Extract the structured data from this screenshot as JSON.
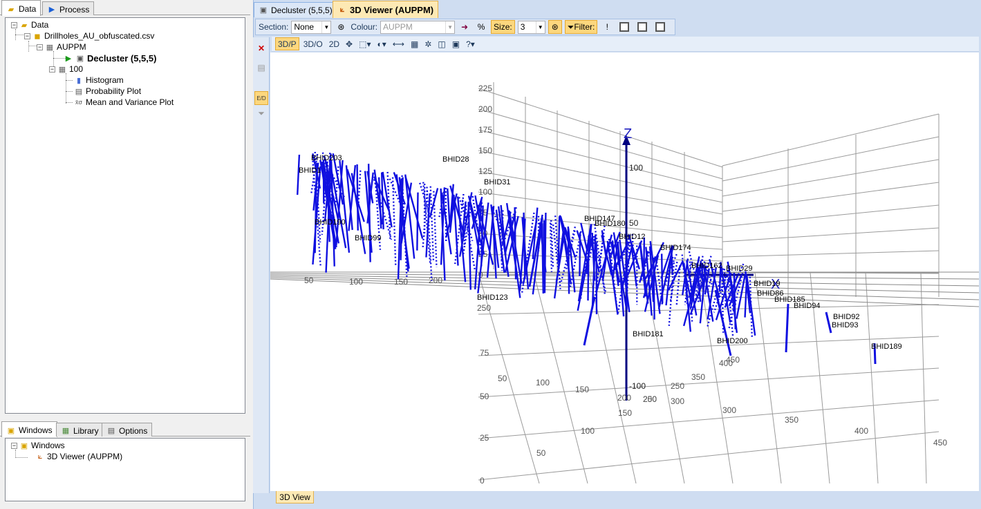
{
  "left_tabs": [
    {
      "label": "Data"
    },
    {
      "label": "Process"
    }
  ],
  "tree": {
    "root": "Data",
    "file": "Drillholes_AU_obfuscated.csv",
    "variable": "AUPPM",
    "decluster": "Decluster (5,5,5)",
    "group": "100",
    "children": [
      "Histogram",
      "Probability Plot",
      "Mean and Variance Plot"
    ]
  },
  "bottom_tabs": [
    {
      "label": "Windows"
    },
    {
      "label": "Library"
    },
    {
      "label": "Options"
    }
  ],
  "windows": {
    "root": "Windows",
    "item": "3D Viewer (AUPPM)"
  },
  "doc_tabs": [
    {
      "label": "Decluster (5,5,5)"
    },
    {
      "label": "3D Viewer (AUPPM)"
    }
  ],
  "toolbar": {
    "section_label": "Section:",
    "section_value": "None",
    "colour_label": "Colour:",
    "colour_value": "AUPPM",
    "percent_label": "%",
    "size_label": "Size:",
    "size_value": "3",
    "filter_label": "Filter:",
    "bang_label": "!"
  },
  "view_toolbar": {
    "btn_3dp": "3D/P",
    "btn_3do": "3D/O",
    "btn_2d": "2D",
    "help": "?"
  },
  "bottom_view_tab": "3D View",
  "viewer": {
    "axis_z": "Z",
    "axis_x": "X",
    "z_ticks": [
      "100",
      "50",
      "-100"
    ],
    "back_ticks": [
      "225",
      "200",
      "175",
      "150",
      "125",
      "100",
      "75",
      "50",
      "25",
      "0"
    ],
    "floor_ticks_a": [
      "50",
      "100",
      "150",
      "200",
      "250",
      "300",
      "350",
      "400",
      "450"
    ],
    "floor_ticks_b": [
      "50",
      "100",
      "150",
      "200",
      "250",
      "300",
      "350",
      "400",
      "450"
    ],
    "left_ticks": [
      "50",
      "100",
      "150",
      "200",
      "250"
    ],
    "lower_left_ticks": [
      "75",
      "50",
      "25",
      "0"
    ],
    "hole_labels": [
      "BHID190",
      "BHID203",
      "BHID1",
      "BHID123",
      "BHID181",
      "BHID200",
      "BHID189",
      "BHID94",
      "BHID92",
      "BHID93",
      "BHID19",
      "BHID185",
      "BHID86",
      "BHID31",
      "BHID147",
      "BHID180",
      "BHID174",
      "BHID162",
      "BHID29",
      "BHID99",
      "BHID28",
      "BHID12"
    ]
  },
  "colors": {
    "points": "#1010e0",
    "z_axis": "#000080",
    "accent": "#fcd77e"
  }
}
